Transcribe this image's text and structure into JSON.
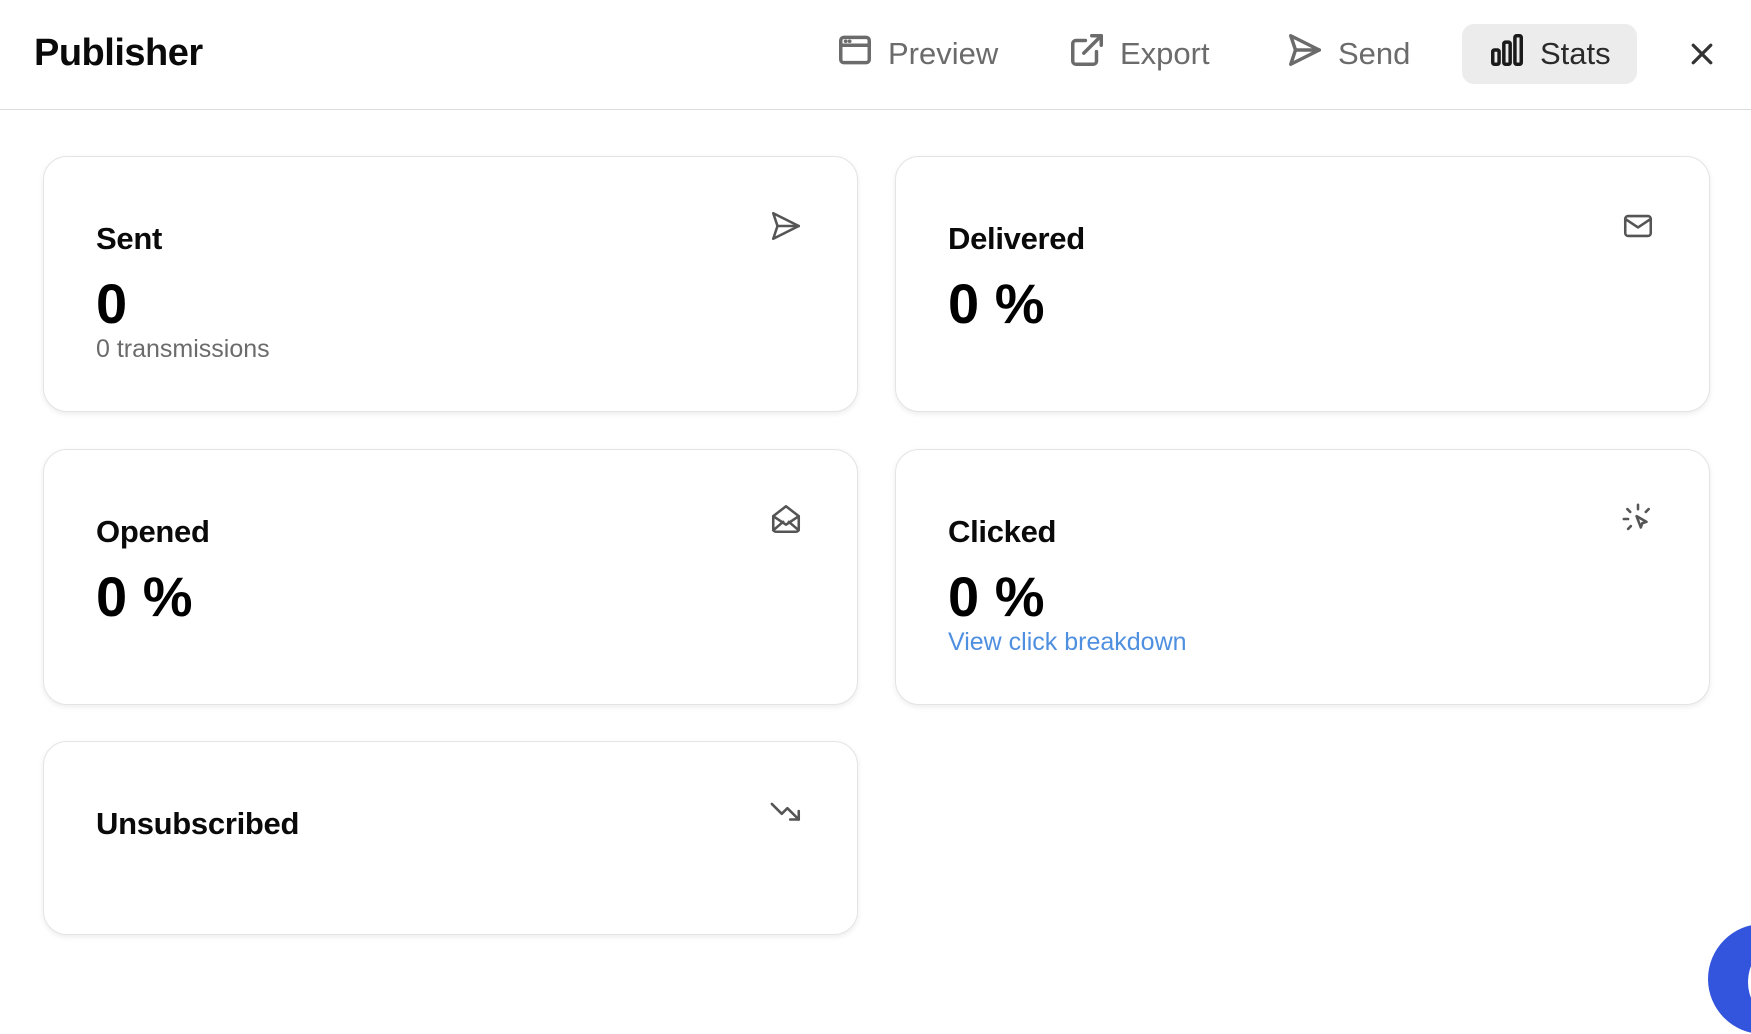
{
  "header": {
    "title": "Publisher",
    "nav": [
      {
        "label": "Preview",
        "icon": "browser-window-icon"
      },
      {
        "label": "Export",
        "icon": "external-link-icon"
      },
      {
        "label": "Send",
        "icon": "send-icon"
      },
      {
        "label": "Stats",
        "icon": "bar-chart-icon",
        "active": true
      }
    ],
    "close_icon": "close-icon"
  },
  "cards": {
    "sent": {
      "title": "Sent",
      "value": "0",
      "sub": "0 transmissions",
      "icon": "send-icon"
    },
    "delivered": {
      "title": "Delivered",
      "value": "0 %",
      "icon": "mail-icon"
    },
    "opened": {
      "title": "Opened",
      "value": "0 %",
      "icon": "mail-open-icon"
    },
    "clicked": {
      "title": "Clicked",
      "value": "0 %",
      "link": "View click breakdown",
      "icon": "cursor-click-icon"
    },
    "unsubscribed": {
      "title": "Unsubscribed",
      "icon": "trending-down-icon"
    }
  },
  "colors": {
    "accent_link": "#4f8fe0",
    "active_tab_bg": "#ececec",
    "chat_launcher": "#3355dd"
  }
}
